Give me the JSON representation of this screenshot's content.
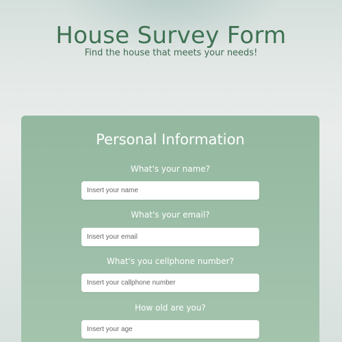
{
  "page": {
    "title": "House Survey Form",
    "subtitle": "Find the house that meets your needs!"
  },
  "form": {
    "section_title": "Personal Information",
    "fields": [
      {
        "label": "What's your name?",
        "placeholder": "Insert your name",
        "value": ""
      },
      {
        "label": "What's your email?",
        "placeholder": "Insert your email",
        "value": ""
      },
      {
        "label": "What's you cellphone number?",
        "placeholder": "Insert your callphone number",
        "value": ""
      },
      {
        "label": "How old are you?",
        "placeholder": "Insert your age",
        "value": ""
      }
    ]
  },
  "colors": {
    "title": "#3f7253",
    "card": "#9ebfa9",
    "card_text": "#ffffff",
    "input_bg": "#ffffff"
  }
}
